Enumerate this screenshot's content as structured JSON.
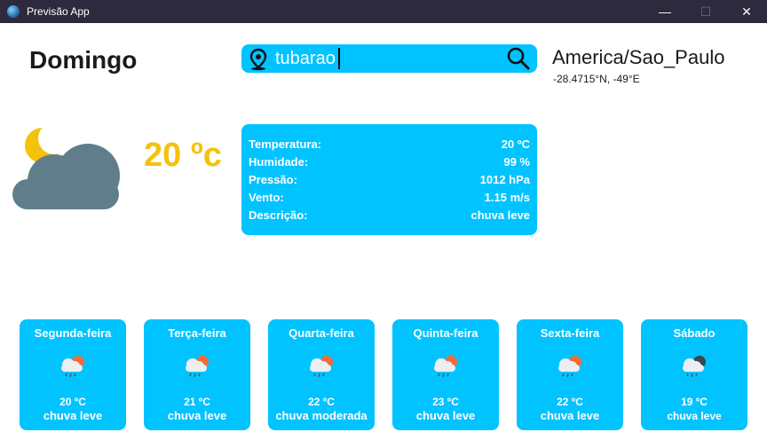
{
  "window": {
    "title": "Previsão App",
    "minimize": "—",
    "maximize": "☐",
    "close": "✕"
  },
  "current": {
    "day": "Domingo",
    "temperature": "20 ºc",
    "icon": "moon-cloud-icon"
  },
  "search": {
    "value": "tubarao"
  },
  "location": {
    "timezone": "America/Sao_Paulo",
    "coords": "-28.4715°N, -49°E"
  },
  "details": [
    {
      "label": "Temperatura:",
      "value": "20 ºC"
    },
    {
      "label": "Humidade:",
      "value": "99 %"
    },
    {
      "label": "Pressão:",
      "value": "1012 hPa"
    },
    {
      "label": "Vento:",
      "value": "1.15 m/s"
    },
    {
      "label": "Descrição:",
      "value": "chuva leve"
    }
  ],
  "forecast": [
    {
      "day": "Segunda-feira",
      "temp": "20 ºC",
      "desc": "chuva leve",
      "icon": "sun-rain-cloud-icon"
    },
    {
      "day": "Terça-feira",
      "temp": "21 ºC",
      "desc": "chuva leve",
      "icon": "sun-rain-cloud-icon"
    },
    {
      "day": "Quarta-feira",
      "temp": "22 ºC",
      "desc": "chuva moderada",
      "icon": "sun-rain-cloud-icon"
    },
    {
      "day": "Quinta-feira",
      "temp": "23 ºC",
      "desc": "chuva leve",
      "icon": "sun-rain-cloud-icon"
    },
    {
      "day": "Sexta-feira",
      "temp": "22 ºC",
      "desc": "chuva leve",
      "icon": "sun-rain-cloud-icon"
    },
    {
      "day": "Sábado",
      "temp": "19 ºC",
      "desc": "chuva leve",
      "icon": "moon-rain-cloud-icon"
    }
  ],
  "colors": {
    "accent": "#00c3ff",
    "temperature": "#f4c20d",
    "titlebar": "#2d2a3e"
  }
}
